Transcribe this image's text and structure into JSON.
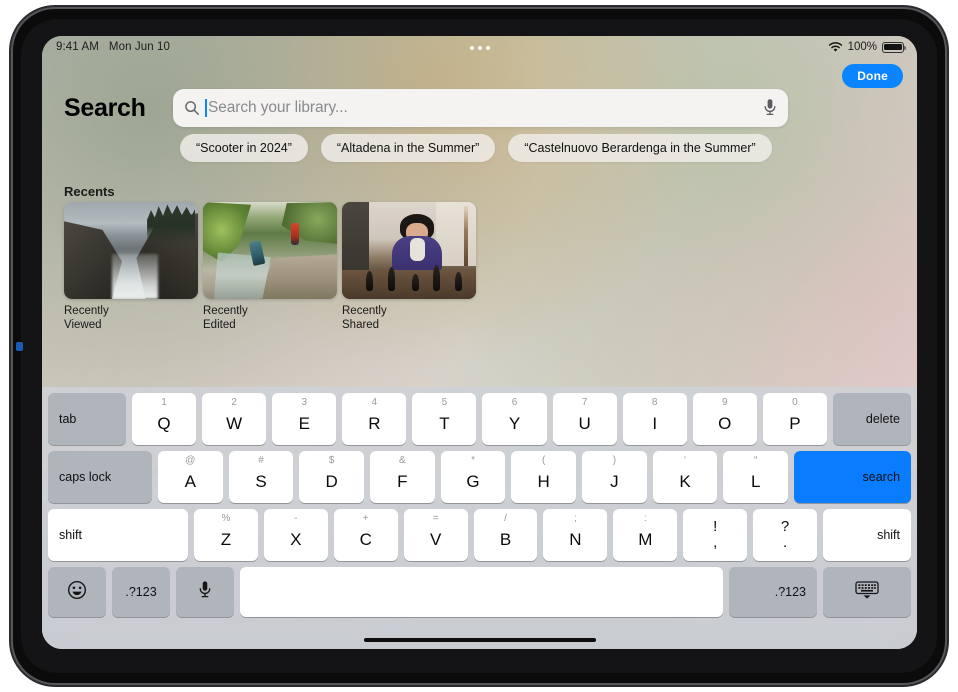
{
  "status_bar": {
    "time": "9:41 AM",
    "date": "Mon Jun 10",
    "battery_percent": "100%",
    "wifi_icon": "wifi-icon",
    "battery_icon": "battery-icon",
    "multitask_icon": "multitask-handle-icon"
  },
  "header": {
    "done_label": "Done",
    "page_title": "Search"
  },
  "search": {
    "placeholder": "Search your library...",
    "value": "",
    "search_icon": "search-icon",
    "mic_icon": "microphone-icon"
  },
  "suggestions": [
    {
      "label": "“Scooter in 2024”"
    },
    {
      "label": "“Altadena in the Summer”"
    },
    {
      "label": "“Castelnuovo Berardenga in the Summer”"
    }
  ],
  "recents": {
    "section_label": "Recents",
    "items": [
      {
        "caption": "Recently Viewed",
        "photo": "coastal-cliffs-photo"
      },
      {
        "caption": "Recently Edited",
        "photo": "creek-forest-photo"
      },
      {
        "caption": "Recently Shared",
        "photo": "girl-playing-chess-photo"
      }
    ]
  },
  "keyboard": {
    "row1": [
      {
        "main": "tab",
        "type": "mod-dark-left"
      },
      {
        "main": "Q",
        "sub": "1"
      },
      {
        "main": "W",
        "sub": "2"
      },
      {
        "main": "E",
        "sub": "3"
      },
      {
        "main": "R",
        "sub": "4"
      },
      {
        "main": "T",
        "sub": "5"
      },
      {
        "main": "Y",
        "sub": "6"
      },
      {
        "main": "U",
        "sub": "7"
      },
      {
        "main": "I",
        "sub": "8"
      },
      {
        "main": "O",
        "sub": "9"
      },
      {
        "main": "P",
        "sub": "0"
      },
      {
        "main": "delete",
        "type": "mod-dark-right"
      }
    ],
    "row2": [
      {
        "main": "caps lock",
        "type": "mod-dark-left"
      },
      {
        "main": "A",
        "sub": "@"
      },
      {
        "main": "S",
        "sub": "#"
      },
      {
        "main": "D",
        "sub": "$"
      },
      {
        "main": "F",
        "sub": "&"
      },
      {
        "main": "G",
        "sub": "*"
      },
      {
        "main": "H",
        "sub": "("
      },
      {
        "main": "J",
        "sub": ")"
      },
      {
        "main": "K",
        "sub": "‘"
      },
      {
        "main": "L",
        "sub": "“"
      },
      {
        "main": "search",
        "type": "mod-blue-right"
      }
    ],
    "row3": [
      {
        "main": "shift",
        "type": "mod-light-left"
      },
      {
        "main": "Z",
        "sub": "%"
      },
      {
        "main": "X",
        "sub": "-"
      },
      {
        "main": "C",
        "sub": "+"
      },
      {
        "main": "V",
        "sub": "="
      },
      {
        "main": "B",
        "sub": "/"
      },
      {
        "main": "N",
        "sub": ";"
      },
      {
        "main": "M",
        "sub": ":"
      },
      {
        "top": "!",
        "bot": ",",
        "type": "twoline"
      },
      {
        "top": "?",
        "bot": ".",
        "type": "twoline"
      },
      {
        "main": "shift",
        "type": "mod-light-right"
      }
    ],
    "row4": [
      {
        "main": "",
        "type": "emoji-key",
        "icon": "emoji-smiley-icon"
      },
      {
        "main": ".?123",
        "type": "mod-dark"
      },
      {
        "main": "",
        "type": "mic-key",
        "icon": "microphone-icon"
      },
      {
        "main": "",
        "type": "space-key"
      },
      {
        "main": ".?123",
        "type": "mod-dark-right"
      },
      {
        "main": "",
        "type": "dismiss-key",
        "icon": "dismiss-keyboard-icon"
      }
    ]
  },
  "colors": {
    "accent_blue": "#0a84ff",
    "keyboard_blue": "#0a7cff",
    "key_dark": "#b0b4bb",
    "key_light": "#ffffff"
  }
}
